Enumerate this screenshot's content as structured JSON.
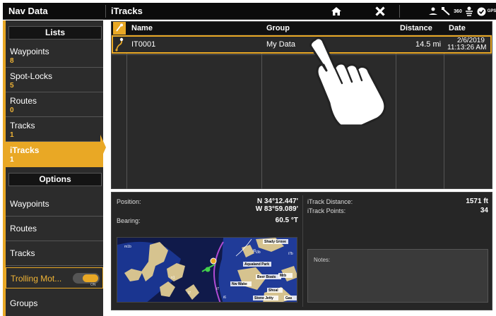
{
  "topbar": {
    "nav_title": "Nav Data",
    "page_title": "iTracks",
    "icons": [
      "home-icon",
      "close-icon",
      "sonar-icon",
      "satellite-icon",
      "360-icon",
      "network-icon",
      "gps-status-icon"
    ],
    "icon_text_360": "360",
    "icon_text_gps": "GPS"
  },
  "sidebar": {
    "lists_header": "Lists",
    "items": [
      {
        "label": "Waypoints",
        "count": "8"
      },
      {
        "label": "Spot-Locks",
        "count": "5"
      },
      {
        "label": "Routes",
        "count": "0"
      },
      {
        "label": "Tracks",
        "count": "1"
      },
      {
        "label": "iTracks",
        "count": "1"
      }
    ],
    "options_header": "Options",
    "options": [
      "Waypoints",
      "Routes",
      "Tracks"
    ],
    "trolling": {
      "label": "Trolling Mot...",
      "toggle_state": "ON"
    },
    "groups_label": "Groups",
    "accent_color": "#e9a825"
  },
  "table": {
    "headers": {
      "name": "Name",
      "group": "Group",
      "distance": "Distance",
      "date": "Date"
    },
    "rows": [
      {
        "name": "IT0001",
        "group": "My Data",
        "distance": "14.5 mi",
        "date": "2/6/2019",
        "time": "11:13:26 AM"
      }
    ]
  },
  "details": {
    "position_label": "Position:",
    "position_lat": "N 34°12.447'",
    "position_lon": "W 83°59.089'",
    "bearing_label": "Bearing:",
    "bearing_value": "60.5 °T",
    "itrack_distance_label": "iTrack Distance:",
    "itrack_distance_value": "1571 ft",
    "itrack_points_label": "iTrack Points:",
    "itrack_points_value": "34",
    "notes_label": "Notes:"
  },
  "map_labels": {
    "shady_grove": "Shady Grove",
    "aqualand_park": "Aqualand Park",
    "beer_boats": "Beer Boats",
    "nw_wake": "Nw Wake",
    "mrb": "Mrb",
    "shoal": "Shoal",
    "stone_jetty": "Stone Jetty",
    "gas": "Gas",
    "i3b": "i3b",
    "i8": "i8",
    "i7b": "i7b",
    "i7": "i7",
    "i6": "i6",
    "m1b": "m1b",
    "n1": "n1",
    "l7": "l7"
  }
}
